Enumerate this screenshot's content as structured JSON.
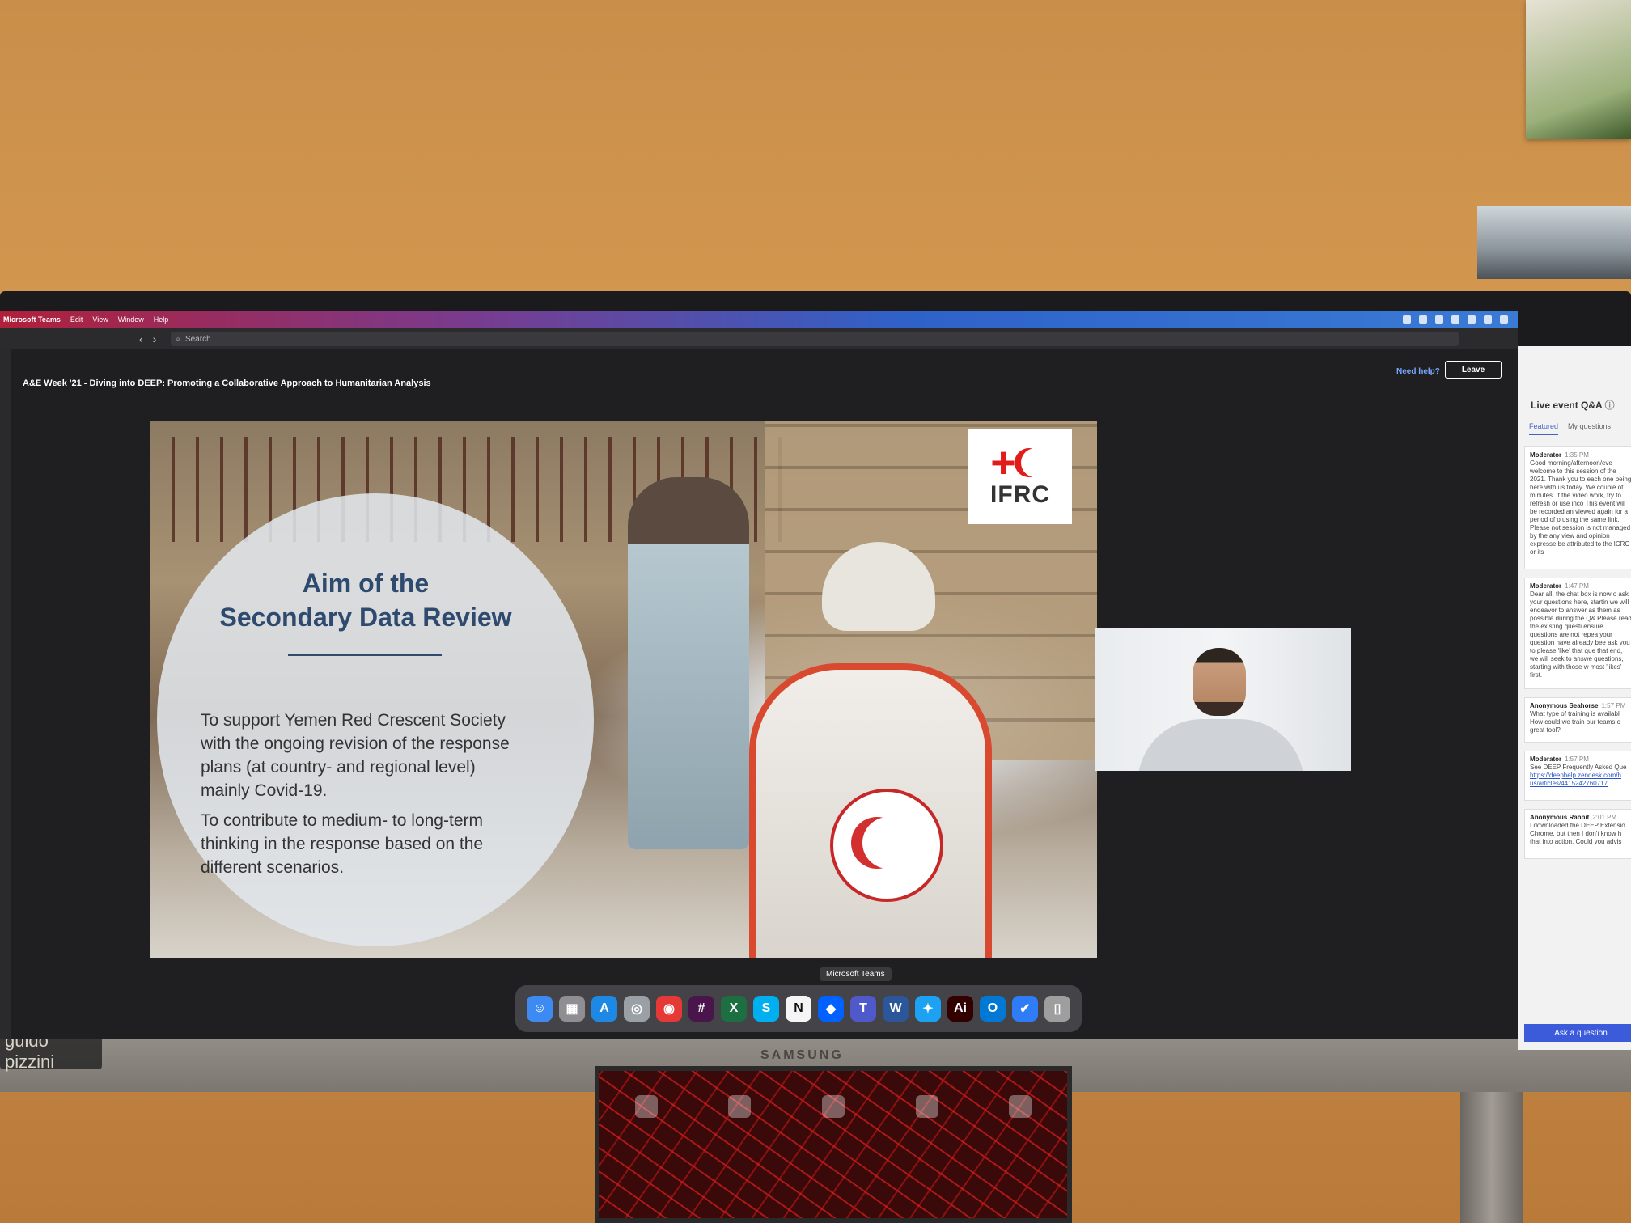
{
  "menubar": {
    "items": [
      "Microsoft Teams",
      "Edit",
      "View",
      "Window",
      "Help"
    ]
  },
  "titlebar": {
    "back": "‹",
    "forward": "›",
    "search_placeholder": "Search"
  },
  "event": {
    "title": "A&E Week '21 - Diving into DEEP: Promoting a Collaborative Approach to Humanitarian Analysis",
    "need_help": "Need help?",
    "leave": "Leave"
  },
  "slide": {
    "heading_line1": "Aim of the",
    "heading_line2": "Secondary Data Review",
    "bullet1": "To support Yemen Red Crescent Society with the ongoing revision of the response plans (at country- and regional level) mainly Covid-19.",
    "bullet2": "To contribute to medium- to long-term thinking in the response based on the different scenarios.",
    "logo_text": "IFRC",
    "logo_cross": "+"
  },
  "qa": {
    "title": "Live event Q&A",
    "tabs": [
      "Featured",
      "My questions"
    ],
    "cards": [
      {
        "author": "Moderator",
        "time": "1:35 PM",
        "text": "Good morning/afternoon/eve welcome to this session of the 2021. Thank you to each one being here with us today. We couple of minutes. If the video work, try to refresh or use inco This event will be recorded an viewed again for a period of o using the same link. Please not session is not managed by the any view and opinion expresse be attributed to the ICRC or its"
      },
      {
        "author": "Moderator",
        "time": "1:47 PM",
        "text": "Dear all, the chat box is now o ask your questions here, startin we will endeavor to answer as them as possible during the Q& Please read the existing questi ensure questions are not repea your question have already bee ask you to please 'like' that que that end, we will seek to answe questions, starting with those w most 'likes' first."
      },
      {
        "author": "Anonymous Seahorse",
        "time": "1:57 PM",
        "text": "What type of training is availabl How could we train our teams o great tool?"
      },
      {
        "author": "Moderator",
        "time": "1:57 PM",
        "text": "See DEEP Frequently Asked Que",
        "link": "https://deephelp.zendesk.com/h us/articles/4415242760717"
      },
      {
        "author": "Anonymous Rabbit",
        "time": "2:01 PM",
        "text": "I downloaded the DEEP Extensio Chrome, but then I don't know h that into action. Could you advis"
      }
    ],
    "ask_button": "Ask a question"
  },
  "dock": {
    "tooltip": "Microsoft Teams",
    "apps": [
      {
        "name": "finder-icon",
        "glyph": "☺",
        "color": "#3d8bf2"
      },
      {
        "name": "launchpad-icon",
        "glyph": "▦",
        "color": "#8e8e93"
      },
      {
        "name": "app-store-icon",
        "glyph": "A",
        "color": "#1e88e5"
      },
      {
        "name": "safari-icon",
        "glyph": "◎",
        "color": "#9aa0a6"
      },
      {
        "name": "chrome-icon",
        "glyph": "◉",
        "color": "#e53935"
      },
      {
        "name": "slack-icon",
        "glyph": "#",
        "color": "#4a154b"
      },
      {
        "name": "excel-icon",
        "glyph": "X",
        "color": "#1d6f42"
      },
      {
        "name": "skype-icon",
        "glyph": "S",
        "color": "#00aff0"
      },
      {
        "name": "notion-icon",
        "glyph": "N",
        "color": "#f5f5f5"
      },
      {
        "name": "dropbox-icon",
        "glyph": "◆",
        "color": "#0061fe"
      },
      {
        "name": "teams-icon",
        "glyph": "T",
        "color": "#5059c9"
      },
      {
        "name": "word-icon",
        "glyph": "W",
        "color": "#2b579a"
      },
      {
        "name": "twitter-icon",
        "glyph": "✦",
        "color": "#1da1f2"
      },
      {
        "name": "illustrator-icon",
        "glyph": "Ai",
        "color": "#330000"
      },
      {
        "name": "outlook-icon",
        "glyph": "O",
        "color": "#0078d4"
      },
      {
        "name": "things-icon",
        "glyph": "✔",
        "color": "#2e7cf6"
      },
      {
        "name": "trash-icon",
        "glyph": "▯",
        "color": "#9e9e9e"
      }
    ]
  },
  "hardware": {
    "monitor_brand": "SAMSUNG",
    "watermark": "guido pizzini"
  }
}
